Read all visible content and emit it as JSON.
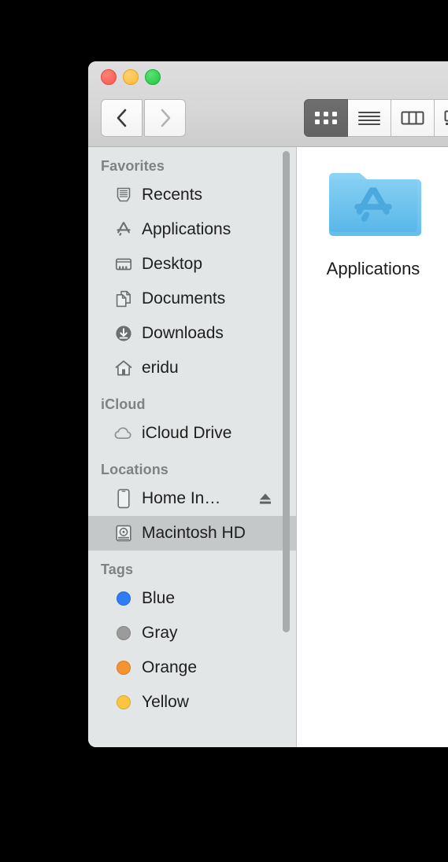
{
  "window": {
    "traffic_lights": [
      {
        "name": "close",
        "color": "#f9564c"
      },
      {
        "name": "minimize",
        "color": "#fcbb2d"
      },
      {
        "name": "zoom",
        "color": "#20c63e"
      }
    ]
  },
  "toolbar": {
    "back_label": "Back",
    "forward_label": "Forward",
    "view_buttons": [
      {
        "name": "icon-view",
        "label": "Icon View",
        "selected": true
      },
      {
        "name": "list-view",
        "label": "List View",
        "selected": false
      },
      {
        "name": "column-view",
        "label": "Column View",
        "selected": false
      },
      {
        "name": "gallery-view",
        "label": "Gallery View",
        "selected": false
      }
    ]
  },
  "sidebar": {
    "sections": [
      {
        "title": "Favorites",
        "items": [
          {
            "label": "Recents",
            "icon": "recents-icon",
            "selected": false
          },
          {
            "label": "Applications",
            "icon": "applications-icon",
            "selected": false
          },
          {
            "label": "Desktop",
            "icon": "desktop-icon",
            "selected": false
          },
          {
            "label": "Documents",
            "icon": "documents-icon",
            "selected": false
          },
          {
            "label": "Downloads",
            "icon": "downloads-icon",
            "selected": false
          },
          {
            "label": "eridu",
            "icon": "home-icon",
            "selected": false
          }
        ]
      },
      {
        "title": "iCloud",
        "items": [
          {
            "label": "iCloud Drive",
            "icon": "icloud-icon",
            "selected": false
          }
        ]
      },
      {
        "title": "Locations",
        "items": [
          {
            "label": "Home In…",
            "icon": "iphone-icon",
            "selected": false,
            "eject": true
          },
          {
            "label": "Macintosh HD",
            "icon": "harddisk-icon",
            "selected": true
          }
        ]
      },
      {
        "title": "Tags",
        "items": [
          {
            "label": "Blue",
            "icon": "tag-dot-icon",
            "color": "#2f7cf6",
            "selected": false
          },
          {
            "label": "Gray",
            "icon": "tag-dot-icon",
            "color": "#9b9b9b",
            "selected": false
          },
          {
            "label": "Orange",
            "icon": "tag-dot-icon",
            "color": "#f59331",
            "selected": false
          },
          {
            "label": "Yellow",
            "icon": "tag-dot-icon",
            "color": "#fbc63f",
            "selected": false
          }
        ]
      }
    ]
  },
  "content": {
    "items": [
      {
        "label": "Applications",
        "icon": "applications-folder-icon"
      }
    ]
  }
}
